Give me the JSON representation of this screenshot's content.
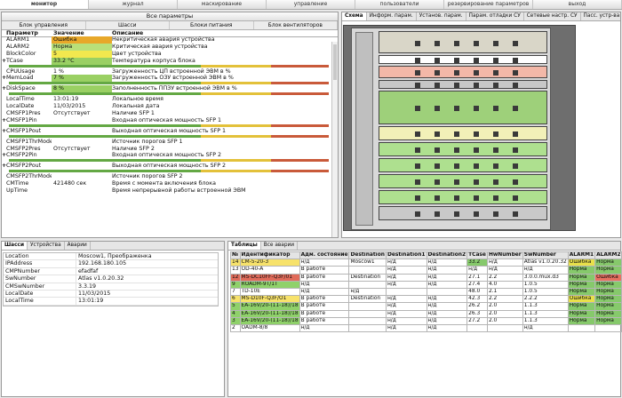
{
  "menu": [
    {
      "label": "монитор",
      "active": true
    },
    {
      "label": "журнал"
    },
    {
      "label": "маскирование"
    },
    {
      "label": "управление"
    },
    {
      "label": "пользователи"
    },
    {
      "label": "резервирование параметров"
    },
    {
      "label": "выход"
    }
  ],
  "params_panel": {
    "title": "Все параметры",
    "subtabs": [
      "Блок управления",
      "Шасси",
      "Блоки питания",
      "Блок вентиляторов"
    ],
    "columns": [
      "Параметр",
      "Значение",
      "Описание"
    ],
    "rows": [
      {
        "p": "ALARM1",
        "v": "Ошибка",
        "d": "Некритическая авария устройства",
        "vc": "#e8a82a"
      },
      {
        "p": "ALARM2",
        "v": "Норма",
        "d": "Критическая авария устройства",
        "vc": "#b9e07a"
      },
      {
        "p": "BlockColor",
        "v": "5",
        "d": "Цвет устройства",
        "vc": "#f2e84e"
      },
      {
        "p": "TCase",
        "v": "33.2 °C",
        "d": "Температура корпуса блока",
        "vc": "#9ad063",
        "exp": true,
        "bar": true
      },
      {
        "p": "CPUUsage",
        "v": "1 %",
        "d": "Загруженность ЦП встроенной ЭВМ в %"
      },
      {
        "p": "MemLoad",
        "v": "7 %",
        "d": "Загруженность ОЗУ встроенной ЭВМ в %",
        "vc": "#9ad063",
        "exp": true,
        "bar": true
      },
      {
        "p": "DiskSpace",
        "v": "8 %",
        "d": "Заполненность ППЗУ встроенной ЭВМ в %",
        "vc": "#9ad063",
        "exp": true,
        "bar": true
      },
      {
        "p": "LocalTime",
        "v": "13:01:19",
        "d": "Локальное время"
      },
      {
        "p": "LocalDate",
        "v": "11/03/2015",
        "d": "Локальная дата"
      },
      {
        "p": "CMSFP1Pres",
        "v": "Отсутствует",
        "d": "Наличие SFP 1"
      },
      {
        "p": "CMSFP1Pin",
        "v": "",
        "d": "Входная оптическая мощность SFP 1",
        "exp": true,
        "bar": true
      },
      {
        "p": "CMSFP1Pout",
        "v": "",
        "d": "Выходная оптическая мощность SFP 1",
        "exp": true,
        "bar": true
      },
      {
        "p": "CMSFP1ThrMode",
        "v": "",
        "d": "Источник порогов SFP 1"
      },
      {
        "p": "CMSFP2Pres",
        "v": "Отсутствует",
        "d": "Наличие SFP 2"
      },
      {
        "p": "CMSFP2Pin",
        "v": "",
        "d": "Входная оптическая мощность SFP 2",
        "exp": true,
        "bar": true
      },
      {
        "p": "CMSFP2Pout",
        "v": "",
        "d": "Выходная оптическая мощность SFP 2",
        "exp": true,
        "bar": true
      },
      {
        "p": "CMSFP2ThrMode",
        "v": "",
        "d": "Источник порогов SFP 2"
      },
      {
        "p": "CMTime",
        "v": "421480 сек",
        "d": "Время с момента включения блока"
      },
      {
        "p": "UpTime",
        "v": "",
        "d": "Время непрерывной работы встроенной ЭВМ"
      }
    ]
  },
  "rack_tabs": [
    "Схема",
    "Информ. парам.",
    "Установ. парам.",
    "Парам. отладки СУ",
    "Сетевые настр. СУ",
    "Пасс. устр-ва"
  ],
  "rack_slots": [
    {
      "label": "",
      "color": "#d9d6c8",
      "h": 25
    },
    {
      "label": "",
      "color": "#ffffff",
      "h": 10
    },
    {
      "label": "",
      "color": "#f3b8a8",
      "h": 14
    },
    {
      "label": "",
      "color": "#c7c7c7",
      "h": 10
    },
    {
      "label": "",
      "color": "#9ed07a",
      "h": 38
    },
    {
      "label": "",
      "color": "#f2f0b8",
      "h": 16
    },
    {
      "label": "",
      "color": "#aee08f",
      "h": 16
    },
    {
      "label": "",
      "color": "#aee08f",
      "h": 16
    },
    {
      "label": "",
      "color": "#aee08f",
      "h": 16
    },
    {
      "label": "",
      "color": "#aee08f",
      "h": 16
    },
    {
      "label": "",
      "color": "#c9c9c9",
      "h": 16
    }
  ],
  "bottom_tabs": [
    "Шасси",
    "Устройства",
    "Аварии"
  ],
  "info": [
    {
      "k": "Location",
      "v": "Moscow1, Преображенка"
    },
    {
      "k": "IPAddress",
      "v": "192.168.180.105"
    },
    {
      "k": "CMPNumber",
      "v": "efadfaf"
    },
    {
      "k": "SwNumber",
      "v": "Atlas v1.0.20.32"
    },
    {
      "k": "CMSwNumber",
      "v": "3.3.19"
    },
    {
      "k": "LocalDate",
      "v": "11/03/2015"
    },
    {
      "k": "LocalTime",
      "v": "13:01:19"
    }
  ],
  "table_tabs": [
    "Таблицы",
    "Все аварии"
  ],
  "table_cols": [
    "№",
    "Идентификатор",
    "Адм. состояние",
    "Destination",
    "Destination1",
    "Destination2",
    "TCase",
    "HwNumber",
    "SwNumber",
    "ALARM1",
    "ALARM2"
  ],
  "table_rows": [
    {
      "n": "14",
      "id": "CM-5-20-3",
      "adm": "н/д",
      "d": "Moscow1",
      "d1": "н/д",
      "d2": "н/д",
      "t": "33.2",
      "hw": "н/д",
      "sw": "Atlas v1.0.20.32",
      "a1": "Ошибка",
      "a2": "Норма",
      "rc": "sty",
      "a1c": "cy",
      "a2c": "cg"
    },
    {
      "n": "13",
      "id": "OD-40-A",
      "adm": "В работе",
      "d": "",
      "d1": "н/д",
      "d2": "н/д",
      "t": "н/д",
      "hw": "н/д",
      "sw": "н/д",
      "a1": "Норма",
      "a2": "Норма",
      "rc": "",
      "a1c": "cg",
      "a2c": "cg"
    },
    {
      "n": "12",
      "id": "MS-DC10FF-Q3F/01",
      "adm": "В работе",
      "d": "Destination",
      "d1": "н/д",
      "d2": "н/д",
      "t": "27.1",
      "hw": "2.2",
      "sw": "3.0.0.mux.d3",
      "a1": "Норма",
      "a2": "Ошибка",
      "rc": "str",
      "a1c": "cg",
      "a2c": "cr"
    },
    {
      "n": "9",
      "id": "ROADM-9T/1T",
      "adm": "н/д",
      "d": "",
      "d1": "н/д",
      "d2": "н/д",
      "t": "27.4",
      "hw": "4.0",
      "sw": "1.0.5",
      "a1": "Норма",
      "a2": "Норма",
      "rc": "stg",
      "a1c": "cg",
      "a2c": "cg"
    },
    {
      "n": "7",
      "id": "TD-10E",
      "adm": "н/д",
      "d": "н/д",
      "d1": "",
      "d2": "",
      "t": "48.0",
      "hw": "2.1",
      "sw": "1.0.5",
      "a1": "Норма",
      "a2": "Норма",
      "rc": "",
      "a1c": "cg",
      "a2c": "cg"
    },
    {
      "n": "6",
      "id": "MS-D10F-Q3F/O1",
      "adm": "В работе",
      "d": "Destination",
      "d1": "н/д",
      "d2": "н/д",
      "t": "42.3",
      "hw": "2.2",
      "sw": "2.2.2",
      "a1": "Ошибка",
      "a2": "Норма",
      "rc": "sty",
      "a1c": "cy",
      "a2c": "cg"
    },
    {
      "n": "5",
      "id": "EA-16V/20-(11-18)/18",
      "adm": "В работе",
      "d": "",
      "d1": "н/д",
      "d2": "н/д",
      "t": "26.2",
      "hw": "2.0",
      "sw": "1.1.3",
      "a1": "Норма",
      "a2": "Норма",
      "rc": "stg",
      "a1c": "cg",
      "a2c": "cg"
    },
    {
      "n": "4",
      "id": "EA-16V/20-(11-18)/18",
      "adm": "В работе",
      "d": "",
      "d1": "н/д",
      "d2": "н/д",
      "t": "26.3",
      "hw": "2.0",
      "sw": "1.1.3",
      "a1": "Норма",
      "a2": "Норма",
      "rc": "stg",
      "a1c": "cg",
      "a2c": "cg"
    },
    {
      "n": "3",
      "id": "EA-16V/20-(11-18)/18",
      "adm": "В работе",
      "d": "",
      "d1": "н/д",
      "d2": "н/д",
      "t": "27.2",
      "hw": "2.0",
      "sw": "1.1.3",
      "a1": "Норма",
      "a2": "Норма",
      "rc": "stg",
      "a1c": "cg",
      "a2c": "cg"
    },
    {
      "n": "2",
      "id": "OADM-8/8",
      "adm": "н/д",
      "d": "",
      "d1": "н/д",
      "d2": "н/д",
      "t": "",
      "hw": "",
      "sw": "н/д",
      "a1": "",
      "a2": "",
      "rc": "",
      "a1c": "",
      "a2c": ""
    }
  ]
}
